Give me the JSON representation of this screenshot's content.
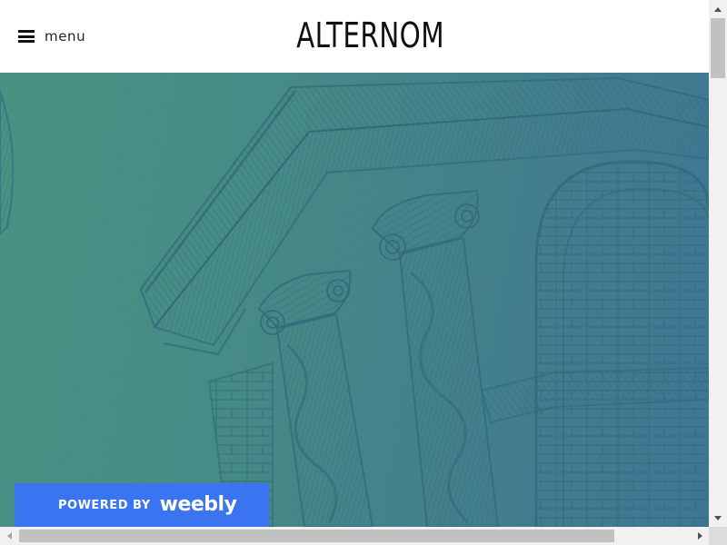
{
  "header": {
    "menu_label": "menu",
    "site_title": "ALTERNOM"
  },
  "hero": {
    "gradient_start": "#4a9283",
    "gradient_end": "#3d7694",
    "engraving_color": "#2e6a78"
  },
  "badge": {
    "powered_by": "POWERED BY",
    "brand": "weebly",
    "background": "#3a74f0"
  },
  "icons": {
    "menu": "hamburger-icon",
    "scroll_up": "arrow-up-icon",
    "scroll_down": "arrow-down-icon",
    "scroll_left": "arrow-left-icon",
    "scroll_right": "arrow-right-icon"
  }
}
